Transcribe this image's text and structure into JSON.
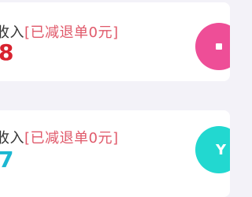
{
  "cards": [
    {
      "label_prefix": "收入",
      "label_note": "[已减退单0元]",
      "value": "8",
      "value_color": "#d8232f",
      "icon": "square-icon",
      "icon_color": "#ee4e97",
      "icon_glyph": ""
    },
    {
      "label_prefix": "收入",
      "label_note": "[已减退单0元]",
      "value": "7",
      "value_color": "#1bb7d2",
      "icon": "yen-icon",
      "icon_color": "#22d8d0",
      "icon_glyph": "Y"
    }
  ]
}
